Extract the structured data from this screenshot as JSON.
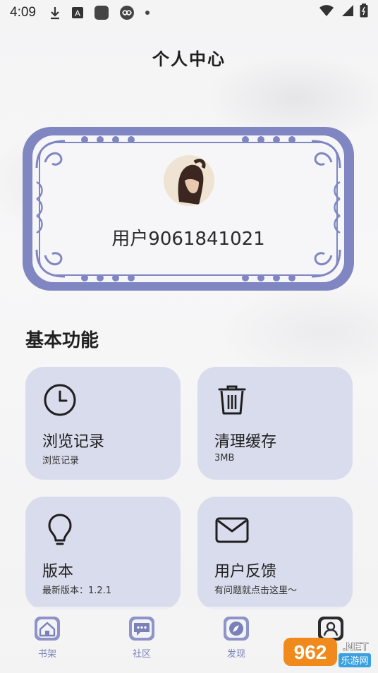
{
  "status_bar": {
    "time": "4:09",
    "left_icons": [
      "download-icon",
      "a-box-icon",
      "square-app-icon",
      "infinity-icon",
      "dot-icon"
    ],
    "right_icons": [
      "wifi-icon",
      "signal-icon",
      "battery-icon"
    ]
  },
  "header": {
    "title": "个人中心"
  },
  "profile": {
    "username": "用户9061841021"
  },
  "section": {
    "title": "基本功能"
  },
  "cards": [
    {
      "id": "history",
      "icon": "clock-icon",
      "title": "浏览记录",
      "subtitle": "浏览记录"
    },
    {
      "id": "cache",
      "icon": "trash-icon",
      "title": "清理缓存",
      "subtitle": "3MB"
    },
    {
      "id": "version",
      "icon": "lightbulb-icon",
      "title": "版本",
      "subtitle": "最新版本：1.2.1"
    },
    {
      "id": "feedback",
      "icon": "envelope-icon",
      "title": "用户反馈",
      "subtitle": "有问题就点击这里～"
    }
  ],
  "bottom_nav": [
    {
      "label": "书架",
      "icon": "home-icon"
    },
    {
      "label": "社区",
      "icon": "chat-icon"
    },
    {
      "label": "发现",
      "icon": "compass-icon"
    },
    {
      "label": "",
      "icon": "user-icon",
      "active": true
    }
  ],
  "watermark": {
    "brand": "962",
    "suffix": ".NET",
    "tagline": "乐游网"
  },
  "colors": {
    "accent": "#7a80b8",
    "card_bg": "#d9dcec",
    "frame": "#7f86c2"
  }
}
